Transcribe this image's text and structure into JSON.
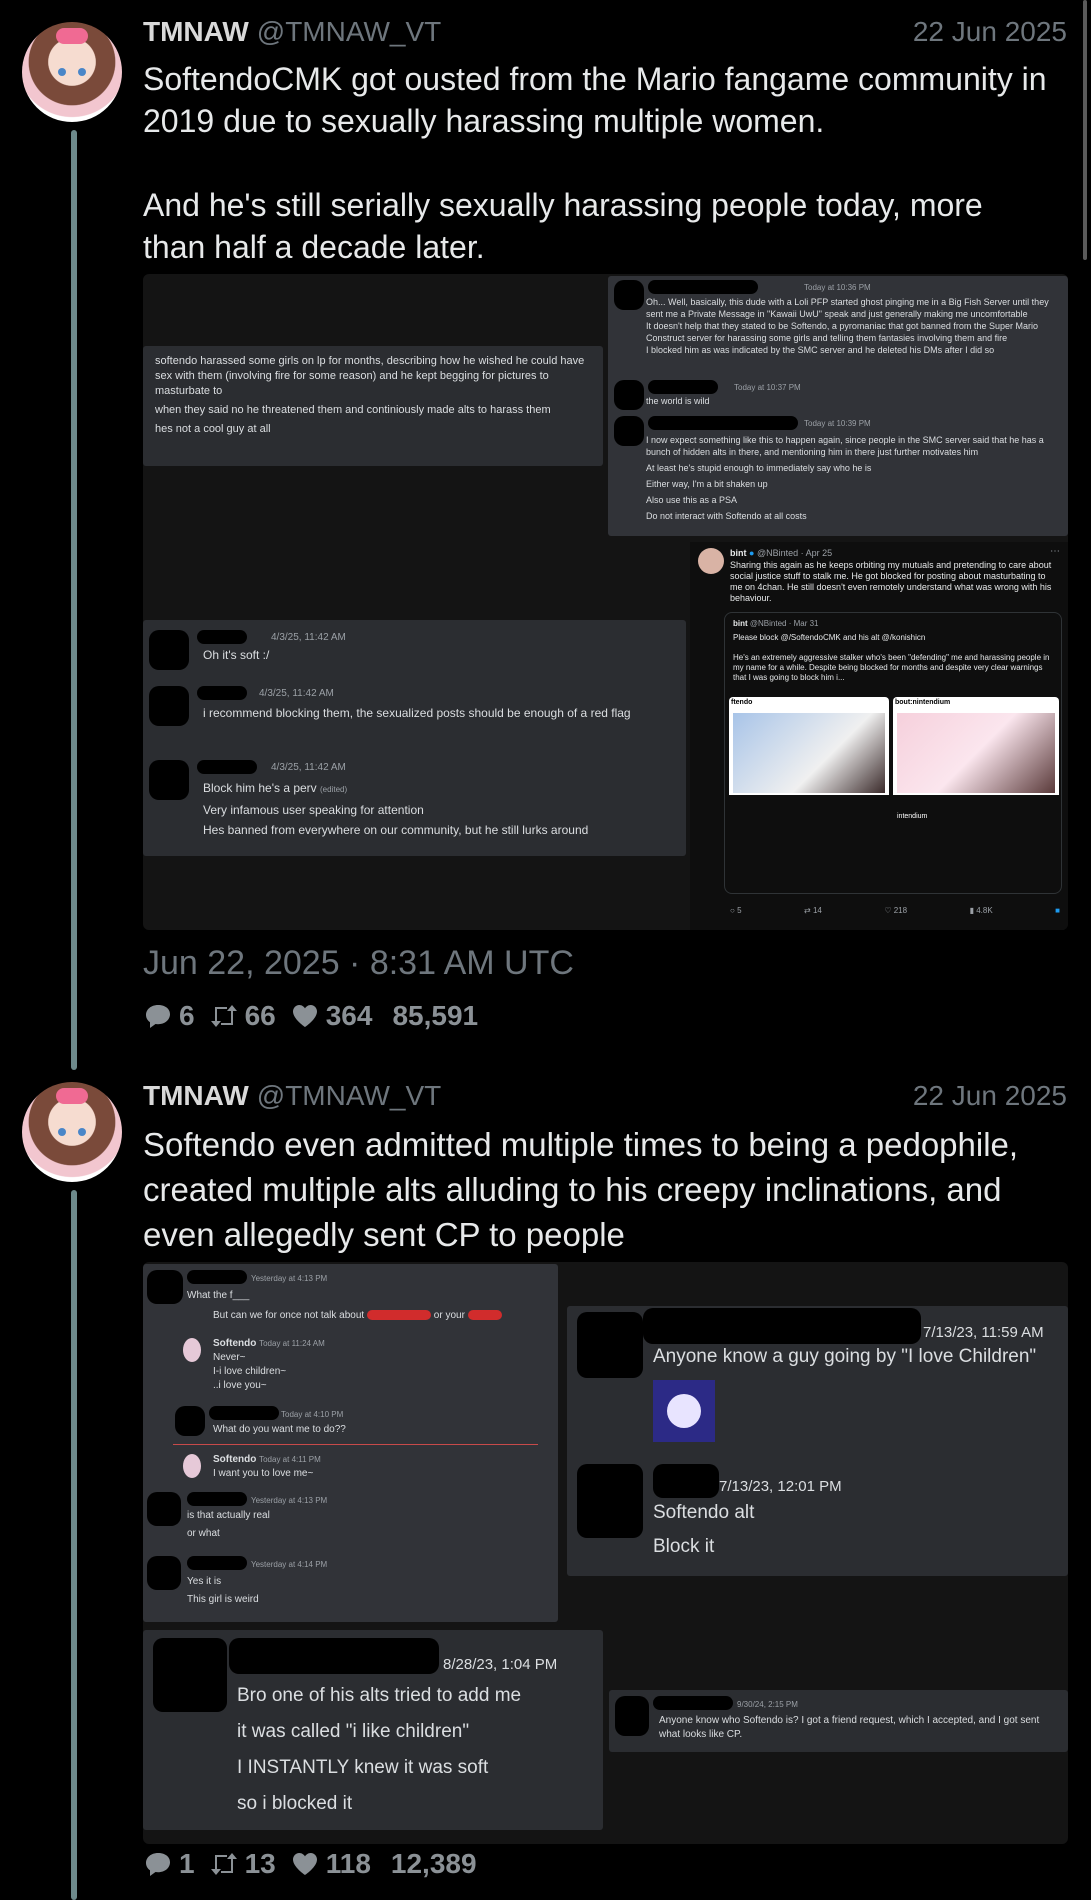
{
  "tweets": [
    {
      "name": "TMNAW",
      "handle": "@TMNAW_VT",
      "date": "22 Jun 2025",
      "text": "SoftendoCMK got ousted from the Mario fangame community in 2019 due to sexually harassing multiple women.\n\nAnd he's still serially sexually harassing people today, more than half a decade later.",
      "timestamp": "Jun 22, 2025 · 8:31 AM UTC",
      "stats": {
        "replies": "6",
        "retweets": "66",
        "likes": "364",
        "views": "85,591"
      }
    },
    {
      "name": "TMNAW",
      "handle": "@TMNAW_VT",
      "date": "22 Jun 2025",
      "text": "Softendo even admitted multiple times to being a pedophile, created multiple alts alluding to his creepy inclinations, and even allegedly sent CP to people",
      "stats": {
        "replies": "1",
        "retweets": "13",
        "likes": "118",
        "views": "12,389"
      }
    }
  ],
  "media1": {
    "left_msg": [
      "softendo harassed some girls on lp for months, describing how he wished he could have sex with them (involving fire for some reason) and he kept begging for pictures to masturbate to",
      "when they said no he threatened them and continiously made alts to harass them",
      "hes not a cool guy at all"
    ],
    "right_top": {
      "ts1": "Today at 10:36 PM",
      "msg1": "Oh... Well, basically, this dude with a Loli PFP started ghost pinging me in a Big Fish Server until they sent me a Private Message in \"Kawaii UwU\" speak and just generally making me uncomfortable",
      "msg2": "It doesn't help that they stated to be Softendo, a pyromaniac that got banned from the Super Mario Construct server for harassing some girls and telling them fantasies involving them and fire",
      "msg3": "I blocked him as was indicated by the SMC server and he deleted his DMs after I did so",
      "ts2": "Today at 10:37 PM",
      "msg4": "the world is wild",
      "ts3": "Today at 10:39 PM",
      "msg5": "I now expect something like this to happen again, since people in the SMC server said that he has a bunch of hidden alts in there, and mentioning him in there just further motivates him",
      "msg6": "At least he's stupid enough to immediately say who he is",
      "msg7": "Either way, I'm a bit shaken up",
      "msg8": "Also use this as a PSA",
      "msg9": "Do not interact with Softendo at all costs"
    },
    "bottom_chat": [
      {
        "ts": "4/3/25, 11:42 AM",
        "lines": [
          "Oh it's soft :/"
        ]
      },
      {
        "ts": "4/3/25, 11:42 AM",
        "lines": [
          "i recommend blocking them, the sexualized posts should be enough of a red flag"
        ]
      },
      {
        "ts": "4/3/25, 11:42 AM",
        "lines": [
          "Block him he's a perv",
          "Very infamous user speaking for attention",
          "Hes banned from everywhere on our community, but he still lurks around"
        ],
        "edited": "(edited)"
      }
    ],
    "bint": {
      "name": "bint",
      "handle": "@NBinted · Apr 25",
      "text": "Sharing this again as he keeps orbiting my mutuals and pretending to care about social justice stuff to stalk me. He got blocked for posting about masturbating to me on 4chan. He still doesn't even remotely understand what was wrong with his behaviour.",
      "quote_handle": "@NBinted · Mar 31",
      "quote_line1": "Please block @/SoftendoCMK and his alt @/konishicn",
      "quote_line2": "He's an extremely aggressive stalker who's been \"defending\" me and harassing people in my name for a while. Despite being blocked for months and despite very clear warnings that I was going to block him i...",
      "img1_label": "ftendo",
      "img2_label": "bout:nintendium",
      "img2_sub": "intendium",
      "stats": [
        "5",
        "14",
        "218",
        "4.8K"
      ]
    }
  },
  "media2": {
    "left_top": {
      "ts1": "Yesterday at 4:13 PM",
      "msg1": "What the f___",
      "msg2a": "But can we for once not talk about",
      "msg2b": "or your",
      "name1": "Softendo",
      "ts2": "Today at 11:24 AM",
      "msg3": "Never~",
      "msg4": "I-i love children~",
      "msg5": "..i love you~",
      "ts3": "Today at 4:10 PM",
      "msg6": "What do you want me to do??",
      "name2": "Softendo",
      "ts4": "Today at 4:11 PM",
      "msg7": "I want you to love me~",
      "ts5": "Yesterday at 4:13 PM",
      "msg8": "is that actually real",
      "msg9": "or what",
      "ts6": "Yesterday at 4:14 PM",
      "msg10": "Yes it is",
      "msg11": "This girl is weird"
    },
    "right_top": {
      "ts1": "7/13/23, 11:59 AM",
      "msg1": "Anyone know a guy going by \"I love Children\"",
      "ts2": "7/13/23, 12:01 PM",
      "msg2": "Softendo alt",
      "msg3": "Block it"
    },
    "left_bottom": {
      "ts": "8/28/23, 1:04 PM",
      "lines": [
        "Bro one of his alts tried to add me",
        "it was called \"i like children\"",
        "I INSTANTLY knew it was soft",
        "so i blocked it"
      ]
    },
    "right_bottom": {
      "ts": "9/30/24, 2:15 PM",
      "msg": "Anyone know who Softendo is? I got a friend request, which I accepted, and I got sent what looks like CP."
    }
  }
}
